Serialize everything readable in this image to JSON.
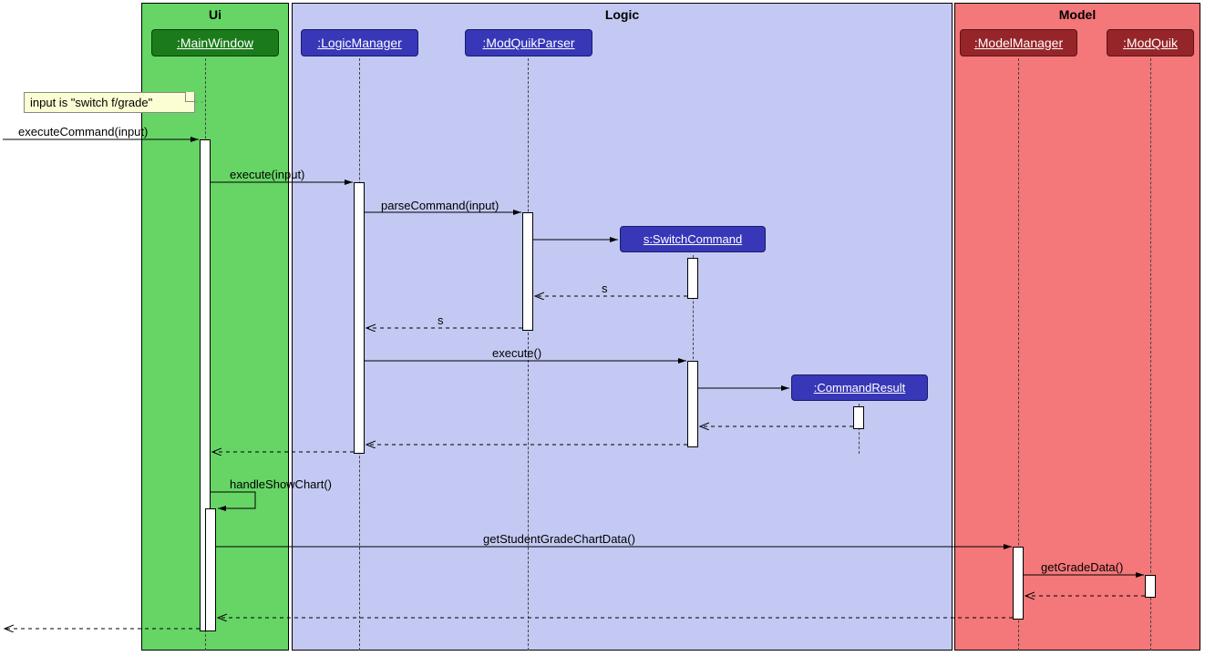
{
  "regions": {
    "ui": "Ui",
    "logic": "Logic",
    "model": "Model"
  },
  "participants": {
    "main": ":MainWindow",
    "logicm": ":LogicManager",
    "parser": ":ModQuikParser",
    "switch": "s:SwitchCommand",
    "cmdres": ":CommandResult",
    "modelm": ":ModelManager",
    "modq": ":ModQuik"
  },
  "note": "input is \"switch f/grade\"",
  "messages": {
    "m1": "executeCommand(input)",
    "m2": "execute(input)",
    "m3": "parseCommand(input)",
    "m4": "s",
    "m5": "s",
    "m6": "execute()",
    "m7": "handleShowChart()",
    "m8": "getStudentGradeChartData()",
    "m9": "getGradeData()"
  }
}
